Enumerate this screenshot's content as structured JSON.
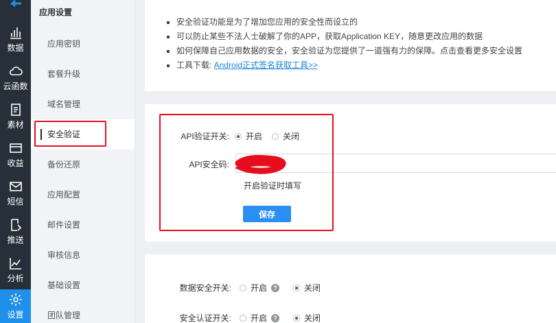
{
  "rail": {
    "items": [
      {
        "label": "数据",
        "icon": "bar-chart-icon"
      },
      {
        "label": "云函数",
        "icon": "cloud-icon"
      },
      {
        "label": "素材",
        "icon": "document-icon"
      },
      {
        "label": "收益",
        "icon": "wallet-icon"
      },
      {
        "label": "短信",
        "icon": "mail-icon"
      },
      {
        "label": "推送",
        "icon": "edit-icon"
      },
      {
        "label": "分析",
        "icon": "line-chart-icon"
      },
      {
        "label": "设置",
        "icon": "gear-icon"
      }
    ],
    "active_color": "#1e90e9"
  },
  "submenu": {
    "title": "应用设置",
    "items": [
      "应用密钥",
      "套餐升级",
      "域名管理",
      "安全验证",
      "备份还原",
      "应用配置",
      "邮件设置",
      "审核信息",
      "基础设置",
      "团队管理"
    ],
    "active": "安全验证"
  },
  "info": {
    "lines": [
      "安全验证功能是为了增加您应用的安全性而设立的",
      "可以防止某些不法人士破解了你的APP，获取Application KEY，随意更改应用的数据",
      "如何保障自己应用数据的安全，安全验证为您提供了一道强有力的保障。点击查看更多安全设置"
    ],
    "tools_prefix": "工具下载: ",
    "tools_link": "Android正式签名获取工具>>"
  },
  "api": {
    "switch_label": "API验证开关:",
    "on_label": "开启",
    "off_label": "关闭",
    "switch_value": "on",
    "code_label": "API安全码:",
    "hint": "开启验证时填写",
    "save_label": "保存"
  },
  "security": {
    "data_switch_label": "数据安全开关:",
    "auth_switch_label": "安全认证开关:",
    "on_label": "开启",
    "off_label": "关闭",
    "help_glyph": "?",
    "data_value": "off",
    "auth_value": "off"
  },
  "colors": {
    "highlight": "#e60e1e",
    "button": "#2a8ff2",
    "link": "#1a82d6"
  }
}
